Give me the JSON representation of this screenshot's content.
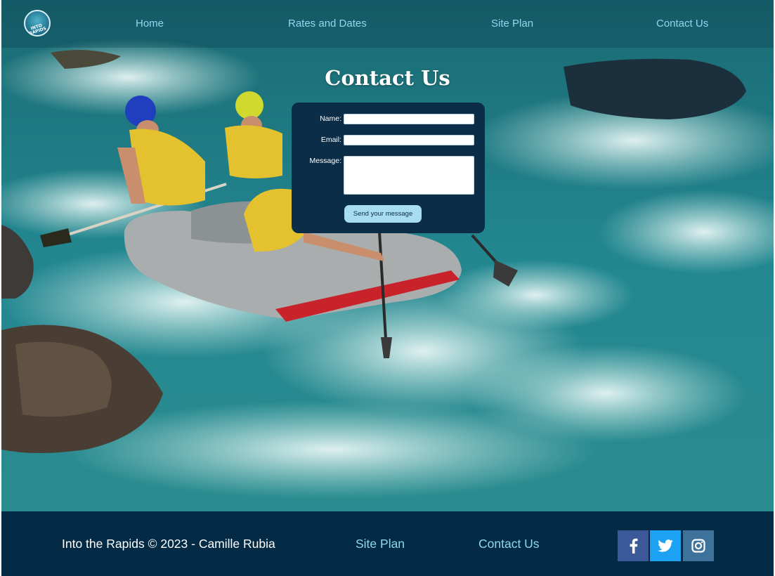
{
  "nav": {
    "logo_text": "INTO RAPIDS",
    "items": [
      {
        "label": "Home"
      },
      {
        "label": "Rates and Dates"
      },
      {
        "label": "Site Plan"
      },
      {
        "label": "Contact Us"
      }
    ]
  },
  "contact": {
    "title": "Contact Us",
    "fields": {
      "name_label": "Name:",
      "email_label": "Email:",
      "message_label": "Message:"
    },
    "send_label": "Send your message"
  },
  "footer": {
    "copyright": "Into the Rapids © 2023 - Camille Rubia",
    "links": [
      {
        "label": "Site Plan"
      },
      {
        "label": "Contact Us"
      }
    ],
    "social": [
      {
        "name": "facebook",
        "icon": "facebook-icon",
        "color": "#3b5998"
      },
      {
        "name": "twitter",
        "icon": "twitter-icon",
        "color": "#1da1f2"
      },
      {
        "name": "instagram",
        "icon": "instagram-icon",
        "color": "#3f729b"
      }
    ]
  },
  "colors": {
    "nav_link": "#8fd8ef",
    "form_bg": "#0b2d48",
    "button_bg": "#a8dcf0",
    "footer_bg": "#032b45"
  }
}
